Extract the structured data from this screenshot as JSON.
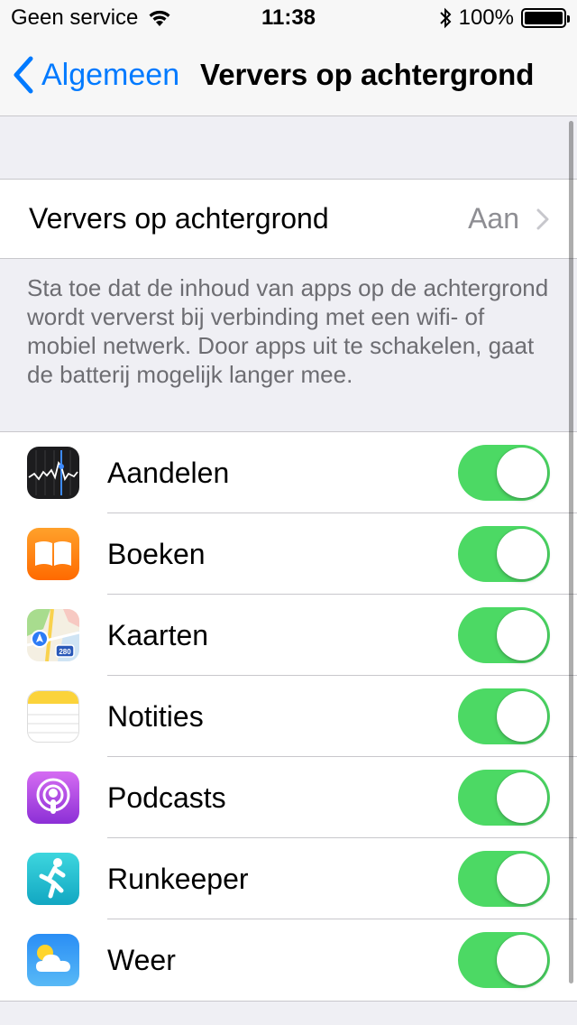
{
  "status_bar": {
    "carrier": "Geen service",
    "time": "11:38",
    "battery_percent": "100%",
    "icons": [
      "wifi-icon",
      "bluetooth-icon",
      "battery-icon"
    ]
  },
  "nav": {
    "back_label": "Algemeen",
    "title": "Ververs op achtergrond"
  },
  "master": {
    "label": "Ververs op achtergrond",
    "value": "Aan"
  },
  "footer": "Sta toe dat de inhoud van apps op de achtergrond wordt ververst bij verbinding met een wifi- of mobiel netwerk. Door apps uit te schakelen, gaat de batterij mogelijk langer mee.",
  "apps": [
    {
      "name": "Aandelen",
      "icon": "stocks-icon",
      "enabled": true
    },
    {
      "name": "Boeken",
      "icon": "books-icon",
      "enabled": true
    },
    {
      "name": "Kaarten",
      "icon": "maps-icon",
      "enabled": true
    },
    {
      "name": "Notities",
      "icon": "notes-icon",
      "enabled": true
    },
    {
      "name": "Podcasts",
      "icon": "podcasts-icon",
      "enabled": true
    },
    {
      "name": "Runkeeper",
      "icon": "runkeeper-icon",
      "enabled": true
    },
    {
      "name": "Weer",
      "icon": "weather-icon",
      "enabled": true
    }
  ],
  "colors": {
    "accent": "#007aff",
    "toggle_on": "#4cd964",
    "background": "#efeff4"
  }
}
